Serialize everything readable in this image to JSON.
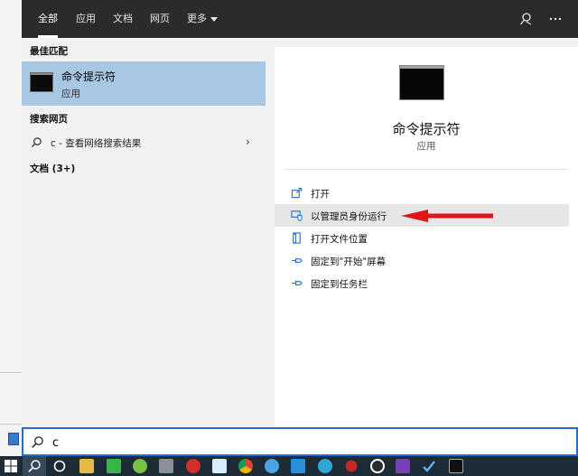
{
  "tabs": [
    "全部",
    "应用",
    "文档",
    "网页",
    "更多"
  ],
  "results": {
    "best_match_header": "最佳匹配",
    "best_match": {
      "title": "命令提示符",
      "subtitle": "应用"
    },
    "web_header": "搜索网页",
    "web_item": "c - 查看网络搜索结果",
    "docs_header": "文档 (3+)"
  },
  "preview": {
    "title": "命令提示符",
    "subtitle": "应用",
    "actions": [
      "打开",
      "以管理员身份运行",
      "打开文件位置",
      "固定到\"开始\"屏幕",
      "固定到任务栏"
    ]
  },
  "search": {
    "value": "c"
  },
  "colors": {
    "accent": "#1e6fd0",
    "highlight": "#a8c7e2",
    "arrow": "#e0141b"
  },
  "icons": {
    "top": [
      "feedback-icon",
      "more-options-icon"
    ],
    "taskbar": [
      "windows-start-icon",
      "search-icon",
      "task-view-icon",
      "file-explorer-icon",
      "app-green-icon",
      "app-lime-icon",
      "app-tools-icon",
      "app-red-icon",
      "app-bilibili-icon",
      "chrome-icon",
      "app-blue-icon",
      "vscode-icon",
      "edge-icon",
      "app-red-dot-icon",
      "app-obs-icon",
      "onenote-icon",
      "app-check-icon",
      "command-prompt-icon"
    ]
  }
}
